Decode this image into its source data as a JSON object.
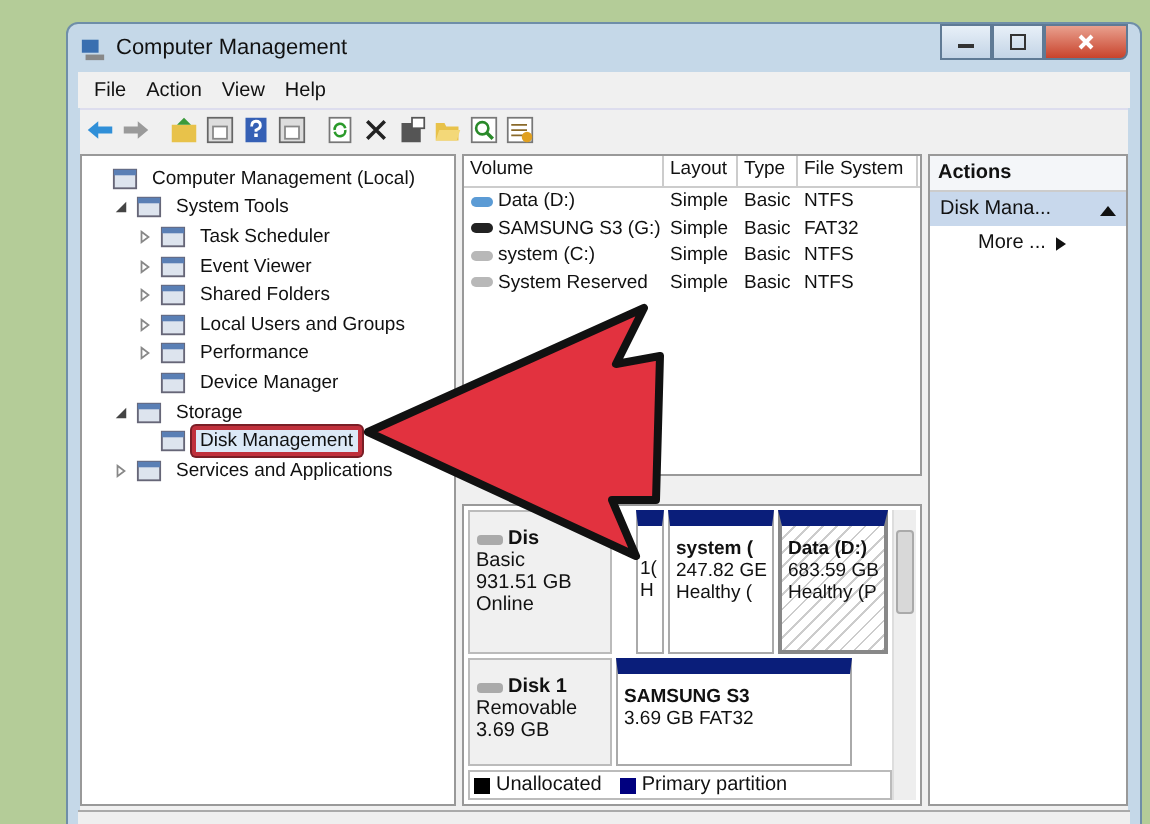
{
  "window": {
    "title": "Computer Management"
  },
  "menu": [
    "File",
    "Action",
    "View",
    "Help"
  ],
  "tree": [
    {
      "label": "Computer Management (Local)",
      "selected": false,
      "children": [
        {
          "label": "System Tools",
          "kind": "open",
          "selected": false,
          "children": [
            {
              "label": "Task Scheduler",
              "kind": "closed",
              "selected": false
            },
            {
              "label": "Event Viewer",
              "kind": "closed",
              "selected": false
            },
            {
              "label": "Shared Folders",
              "kind": "closed",
              "selected": false
            },
            {
              "label": "Local Users and Groups",
              "kind": "closed",
              "selected": false
            },
            {
              "label": "Performance",
              "kind": "closed",
              "selected": false
            },
            {
              "label": "Device Manager",
              "kind": "leaf",
              "selected": false
            }
          ]
        },
        {
          "label": "Storage",
          "kind": "open",
          "selected": false,
          "children": [
            {
              "label": "Disk Management",
              "kind": "leaf",
              "selected": true
            }
          ]
        },
        {
          "label": "Services and Applications",
          "kind": "closed",
          "selected": false
        }
      ]
    }
  ],
  "volumes": {
    "columns": [
      "Volume",
      "Layout",
      "Type",
      "File System"
    ],
    "rows": [
      {
        "volume": "Data (D:)",
        "layout": "Simple",
        "type": "Basic",
        "file_system": "NTFS",
        "color": "#5b9bd5"
      },
      {
        "volume": "SAMSUNG S3 (G:)",
        "layout": "Simple",
        "type": "Basic",
        "file_system": "FAT32",
        "color": "#222222"
      },
      {
        "volume": "system (C:)",
        "layout": "Simple",
        "type": "Basic",
        "file_system": "NTFS",
        "color": "#b8b8b8"
      },
      {
        "volume": "System Reserved",
        "layout": "Simple",
        "type": "Basic",
        "file_system": "NTFS",
        "color": "#b8b8b8"
      }
    ]
  },
  "disks": [
    {
      "name": "Dis",
      "type": "Basic",
      "size": "931.51 GB",
      "status": "Online",
      "partitions": [
        {
          "size": "1(",
          "status": "H",
          "selected": false
        },
        {
          "name": "system (",
          "size": "247.82 GE",
          "status": "Healthy (",
          "selected": false
        },
        {
          "name": "Data  (D:)",
          "size": "683.59 GB",
          "status": "Healthy (P",
          "selected": true
        }
      ]
    },
    {
      "name": "Disk 1",
      "type": "Removable",
      "size": "3.69 GB",
      "partitions": [
        {
          "name": "SAMSUNG S3",
          "size": "3.69 GB FAT32",
          "selected": false
        }
      ]
    }
  ],
  "legend": [
    {
      "label": "Unallocated",
      "color": "#000000"
    },
    {
      "label": "Primary partition",
      "color": "#00007f"
    }
  ],
  "actions": {
    "title": "Actions",
    "items": [
      {
        "label": "Disk Mana...",
        "kind": "section"
      },
      {
        "label": "More ...",
        "kind": "item"
      }
    ]
  }
}
